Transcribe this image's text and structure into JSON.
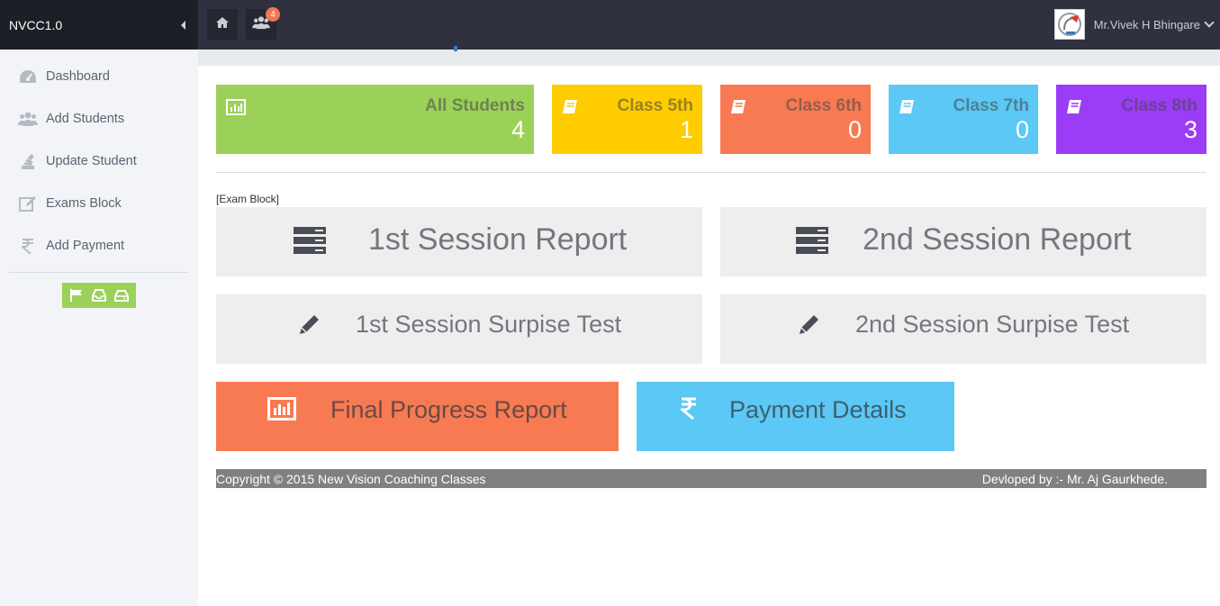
{
  "brand": {
    "title": "NVCC1.0"
  },
  "sidebar": {
    "items": [
      {
        "label": "Dashboard",
        "icon": "dashboard-icon"
      },
      {
        "label": "Add Students",
        "icon": "users-icon"
      },
      {
        "label": "Update Student",
        "icon": "stack-icon"
      },
      {
        "label": "Exams Block",
        "icon": "edit-icon"
      },
      {
        "label": "Add Payment",
        "icon": "rupee-icon"
      }
    ],
    "quick_buttons": [
      "flag-icon",
      "inbox-icon",
      "hdd-icon"
    ]
  },
  "topbar": {
    "notification_count": "4",
    "user_name": "Mr.Vivek H Bhingare"
  },
  "stats": [
    {
      "title": "All Students",
      "count": "4",
      "color": "#9cd159"
    },
    {
      "title": "Class 5th",
      "count": "1",
      "color": "#ffcc00"
    },
    {
      "title": "Class 6th",
      "count": "0",
      "color": "#f87a53"
    },
    {
      "title": "Class 7th",
      "count": "0",
      "color": "#5bc8f5"
    },
    {
      "title": "Class 8th",
      "count": "3",
      "color": "#9b3cf6"
    }
  ],
  "exam_block_label": "[Exam Block]",
  "tiles": {
    "session1_report": "1st Session Report",
    "session2_report": "2nd Session Report",
    "session1_test": "1st Session Surpise Test",
    "session2_test": "2nd Session Surpise Test",
    "final_report": "Final Progress Report",
    "payment_details": "Payment Details"
  },
  "footer": {
    "copyright": "Copyright © 2015 New Vision Coaching Classes",
    "developer": "Devloped by :- Mr. Aj Gaurkhede."
  }
}
